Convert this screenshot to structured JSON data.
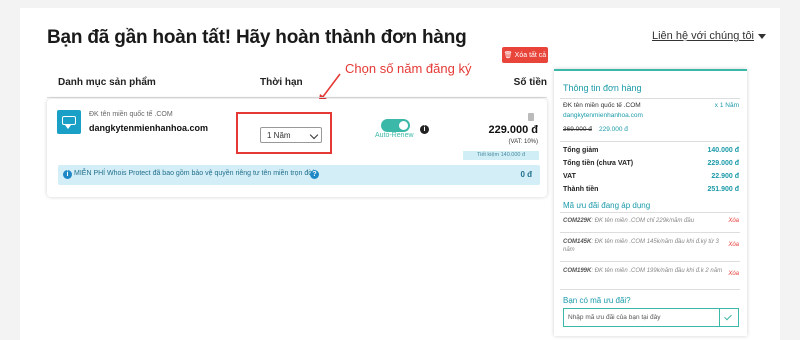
{
  "header": {
    "title": "Bạn đã gần hoàn tất! Hãy hoàn thành đơn hàng",
    "contact_label": "Liên hệ với chúng tôi"
  },
  "cart": {
    "delete_all_label": "Xóa tất cả",
    "annotation": "Chọn số năm đăng ký",
    "columns": {
      "product": "Danh mục sản phẩm",
      "period": "Thời hạn",
      "amount": "Số tiền"
    },
    "item": {
      "type": "ĐK tên miền quốc tế .COM",
      "domain": "dangkytenmienhanhoa.com",
      "period_selected": "1 Năm",
      "auto_renew_label": "Auto-Renew",
      "auto_renew_on": true,
      "price": "229.000 đ",
      "vat_note": "(VAT: 10%)",
      "saving": "Tiết kiệm 140.000 đ"
    },
    "promo": {
      "text": "MIỄN PHÍ Whois Protect đã bao gồm bảo vệ quyền riêng tư tên miền trọn đời",
      "amount": "0 đ"
    }
  },
  "summary": {
    "title": "Thông tin đơn hàng",
    "item_name": "ĐK tên miền quốc tế .COM",
    "item_qty": "x 1 Năm",
    "item_domain": "dangkytenmienhanhoa.com",
    "item_old_price": "369.000 đ",
    "item_new_price": "229.000 đ",
    "rows": [
      {
        "label": "Tổng giảm",
        "value": "140.000 đ"
      },
      {
        "label": "Tổng tiền (chưa VAT)",
        "value": "229.000 đ"
      },
      {
        "label": "VAT",
        "value": "22.900 đ"
      },
      {
        "label": "Thành tiền",
        "value": "251.900 đ"
      }
    ],
    "discounts_title": "Mã ưu đãi đang áp dụng",
    "discounts": [
      {
        "code": "COM229K",
        "desc": ": ĐK tên miền .COM chỉ 229k/năm đầu",
        "remove": "Xóa"
      },
      {
        "code": "COM145K",
        "desc": ": ĐK tên miền .COM 145k/năm đầu khi đ.ký từ 3 năm",
        "remove": "Xóa"
      },
      {
        "code": "COM199K",
        "desc": ": ĐK tên miền .COM 199k/năm đầu khi đ.k 2 năm",
        "remove": "Xóa"
      }
    ],
    "code_question": "Bạn có mã ưu đãi?",
    "code_placeholder": "Nhập mã ưu đãi của bạn tại đây"
  }
}
